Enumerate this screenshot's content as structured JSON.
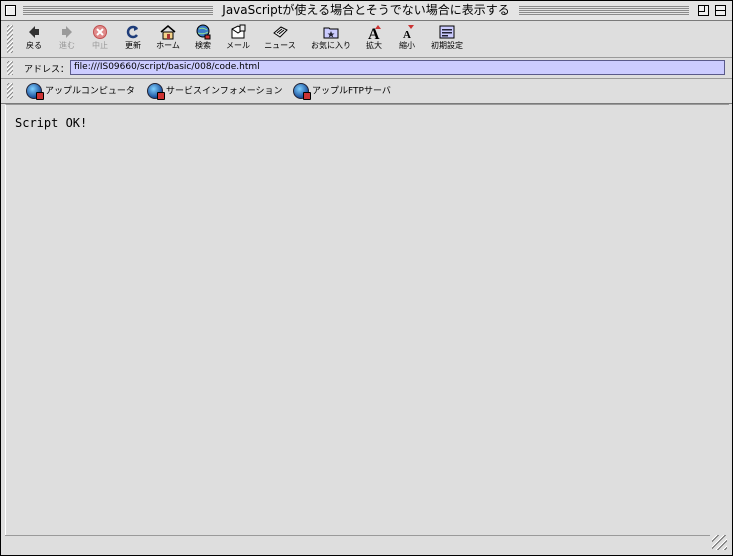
{
  "window": {
    "title": "JavaScriptが使える場合とそうでない場合に表示する"
  },
  "toolbar": {
    "buttons": [
      {
        "label": "戻る",
        "icon": "back-arrow-icon",
        "enabled": true
      },
      {
        "label": "進む",
        "icon": "forward-arrow-icon",
        "enabled": false
      },
      {
        "label": "中止",
        "icon": "stop-icon",
        "enabled": false
      },
      {
        "label": "更新",
        "icon": "refresh-icon",
        "enabled": true
      },
      {
        "label": "ホーム",
        "icon": "home-icon",
        "enabled": true
      },
      {
        "label": "検索",
        "icon": "search-globe-icon",
        "enabled": true
      },
      {
        "label": "メール",
        "icon": "mail-icon",
        "enabled": true
      },
      {
        "label": "ニュース",
        "icon": "news-icon",
        "enabled": true
      },
      {
        "label": "お気に入り",
        "icon": "favorites-folder-icon",
        "enabled": true
      },
      {
        "label": "拡大",
        "icon": "text-larger-icon",
        "enabled": true
      },
      {
        "label": "縮小",
        "icon": "text-smaller-icon",
        "enabled": true
      },
      {
        "label": "初期設定",
        "icon": "preferences-icon",
        "enabled": true
      }
    ]
  },
  "address": {
    "label": "アドレス：",
    "value": "file:///IS09660/script/basic/008/code.html"
  },
  "favorites": [
    {
      "label": "アップルコンピュータ",
      "icon": "globe-icon"
    },
    {
      "label": "サービスインフォメーション",
      "icon": "globe-icon"
    },
    {
      "label": "アップルFTPサーバ",
      "icon": "globe-icon"
    }
  ],
  "page": {
    "text": "Script OK!"
  },
  "colors": {
    "address_bg": "#ccccff",
    "chrome": "#dedede",
    "stop_red": "#d04040"
  }
}
